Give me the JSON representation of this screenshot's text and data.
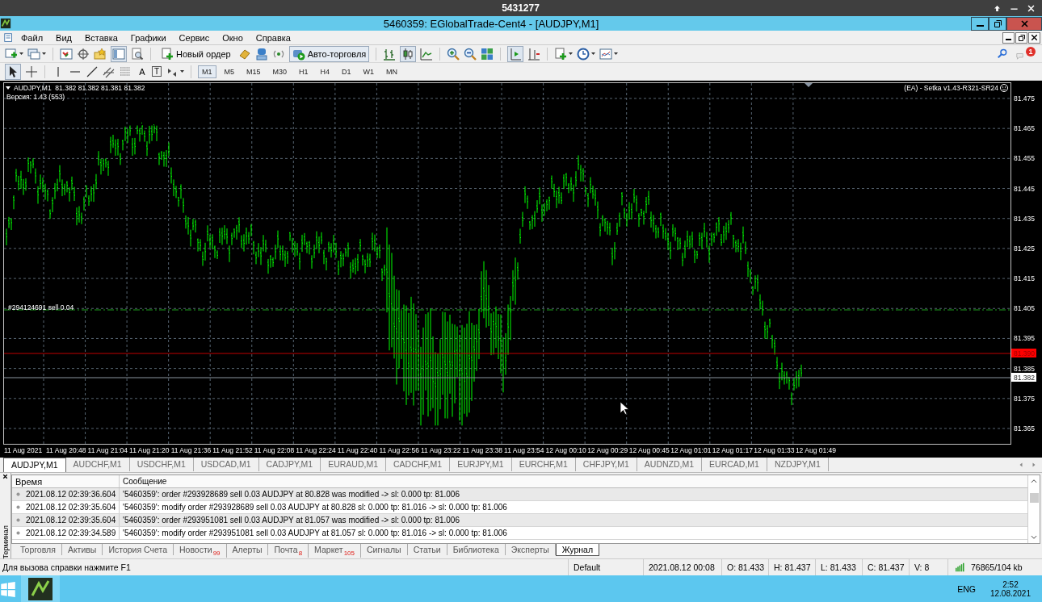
{
  "os_window": {
    "title": "5431277"
  },
  "window": {
    "title": "5460359: EGlobalTrade-Cent4 - [AUDJPY,M1]"
  },
  "menu": [
    "Файл",
    "Вид",
    "Вставка",
    "Графики",
    "Сервис",
    "Окно",
    "Справка"
  ],
  "toolbar": {
    "new_order": "Новый ордер",
    "auto_trading": "Авто-торговля",
    "notification_count": "1",
    "text_tool": "A",
    "label_tool": "T"
  },
  "timeframes": [
    {
      "label": "M1",
      "selected": true
    },
    {
      "label": "M5",
      "selected": false
    },
    {
      "label": "M15",
      "selected": false
    },
    {
      "label": "M30",
      "selected": false
    },
    {
      "label": "H1",
      "selected": false
    },
    {
      "label": "H4",
      "selected": false
    },
    {
      "label": "D1",
      "selected": false
    },
    {
      "label": "W1",
      "selected": false
    },
    {
      "label": "MN",
      "selected": false
    }
  ],
  "chart": {
    "symbol_line": "AUDJPY,M1  81.382 81.382 81.381 81.382",
    "version": "Версия: 1.43 (553)",
    "expert": "(EA) - Setka v1.43-R321-SR24",
    "order_label": "#294124691 sell 0.04",
    "price_labels": [
      "81.475",
      "81.465",
      "81.455",
      "81.445",
      "81.435",
      "81.425",
      "81.415",
      "81.405",
      "81.395",
      "81.385",
      "81.375",
      "81.365"
    ],
    "time_labels": [
      "11 Aug 2021",
      "11 Aug 20:48",
      "11 Aug 21:04",
      "11 Aug 21:20",
      "11 Aug 21:36",
      "11 Aug 21:52",
      "11 Aug 22:08",
      "11 Aug 22:24",
      "11 Aug 22:40",
      "11 Aug 22:56",
      "11 Aug 23:22",
      "11 Aug 23:38",
      "11 Aug 23:54",
      "12 Aug 00:10",
      "12 Aug 00:29",
      "12 Aug 00:45",
      "12 Aug 01:01",
      "12 Aug 01:17",
      "12 Aug 01:33",
      "12 Aug 01:49"
    ],
    "level_marker": "81.390",
    "bid_marker": "81.382"
  },
  "chart_tabs": [
    {
      "label": "AUDJPY,M1",
      "selected": true
    },
    {
      "label": "AUDCHF,M1",
      "selected": false
    },
    {
      "label": "USDCHF,M1",
      "selected": false
    },
    {
      "label": "USDCAD,M1",
      "selected": false
    },
    {
      "label": "CADJPY,M1",
      "selected": false
    },
    {
      "label": "EURAUD,M1",
      "selected": false
    },
    {
      "label": "CADCHF,M1",
      "selected": false
    },
    {
      "label": "EURJPY,M1",
      "selected": false
    },
    {
      "label": "EURCHF,M1",
      "selected": false
    },
    {
      "label": "CHFJPY,M1",
      "selected": false
    },
    {
      "label": "AUDNZD,M1",
      "selected": false
    },
    {
      "label": "EURCAD,M1",
      "selected": false
    },
    {
      "label": "NZDJPY,M1",
      "selected": false
    }
  ],
  "terminal": {
    "side_label": "Терминал",
    "columns": [
      "Время",
      "Сообщение"
    ],
    "rows": [
      {
        "time": "2021.08.12 02:39:36.604",
        "message": "'5460359': order #293928689 sell 0.03 AUDJPY at 80.828 was modified -> sl: 0.000 tp: 81.006"
      },
      {
        "time": "2021.08.12 02:39:35.604",
        "message": "'5460359': modify order #293928689 sell 0.03 AUDJPY at 80.828 sl: 0.000 tp: 81.016 -> sl: 0.000 tp: 81.006"
      },
      {
        "time": "2021.08.12 02:39:35.604",
        "message": "'5460359': order #293951081 sell 0.03 AUDJPY at 81.057 was modified -> sl: 0.000 tp: 81.006"
      },
      {
        "time": "2021.08.12 02:39:34.589",
        "message": "'5460359': modify order #293951081 sell 0.03 AUDJPY at 81.057 sl: 0.000 tp: 81.016 -> sl: 0.000 tp: 81.006"
      }
    ],
    "tabs": [
      {
        "label": "Торговля",
        "selected": false
      },
      {
        "label": "Активы",
        "selected": false
      },
      {
        "label": "История Счета",
        "selected": false
      },
      {
        "label": "Новости",
        "badge": "99",
        "selected": false
      },
      {
        "label": "Алерты",
        "selected": false
      },
      {
        "label": "Почта",
        "badge": "8",
        "selected": false
      },
      {
        "label": "Маркет",
        "badge": "105",
        "selected": false
      },
      {
        "label": "Сигналы",
        "selected": false
      },
      {
        "label": "Статьи",
        "selected": false
      },
      {
        "label": "Библиотека",
        "selected": false
      },
      {
        "label": "Эксперты",
        "selected": false
      },
      {
        "label": "Журнал",
        "selected": true
      }
    ]
  },
  "status_bar": {
    "help": "Для вызова справки нажмите F1",
    "profile": "Default",
    "datetime": "2021.08.12 00:08",
    "open": "O: 81.433",
    "high": "H: 81.437",
    "low": "L: 81.433",
    "close": "C: 81.437",
    "volume": "V: 8",
    "traffic": "76865/104 kb"
  },
  "taskbar": {
    "language": "ENG",
    "time": "2:52",
    "date": "12.08.2021"
  }
}
